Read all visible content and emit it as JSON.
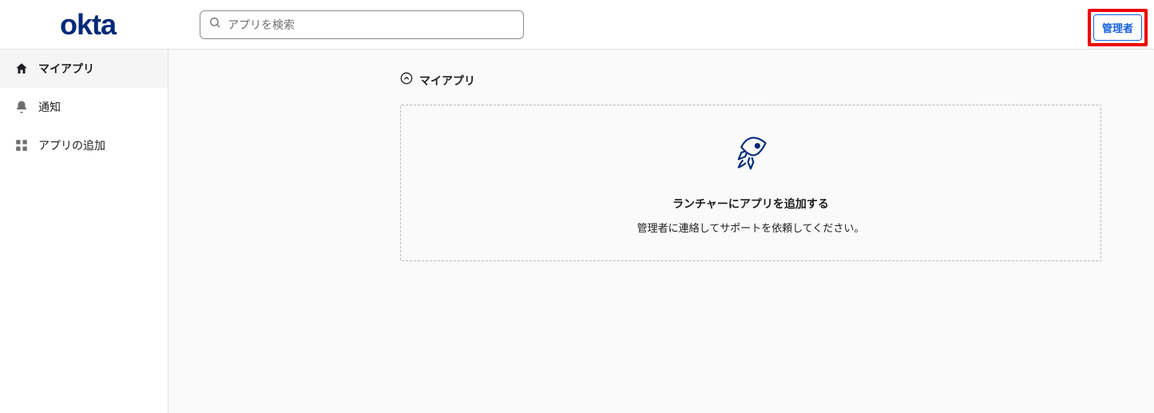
{
  "header": {
    "logo_text": "okta",
    "search_placeholder": "アプリを検索",
    "admin_button": "管理者"
  },
  "sidebar": {
    "items": [
      {
        "label": "マイアプリ",
        "icon": "home",
        "active": true
      },
      {
        "label": "通知",
        "icon": "bell",
        "active": false
      },
      {
        "label": "アプリの追加",
        "icon": "grid-plus",
        "active": false
      }
    ]
  },
  "main": {
    "section_title": "マイアプリ",
    "empty_state": {
      "title": "ランチャーにアプリを追加する",
      "subtitle": "管理者に連絡してサポートを依頼してください。"
    }
  },
  "colors": {
    "brand": "#00297A",
    "accent": "#1662dd",
    "highlight": "#ee0000"
  }
}
